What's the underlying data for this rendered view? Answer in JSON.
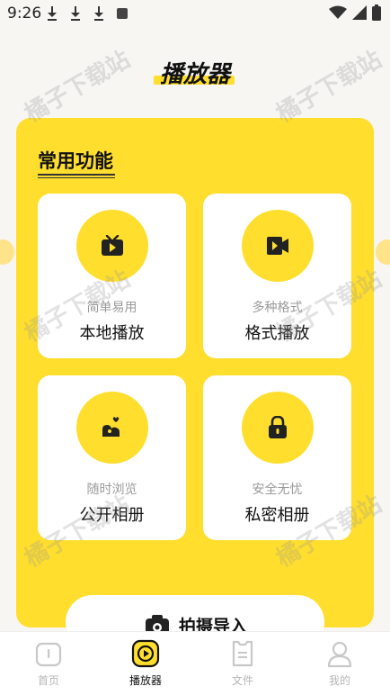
{
  "status": {
    "time": "9:26"
  },
  "header": {
    "title": "播放器"
  },
  "section": {
    "title": "常用功能"
  },
  "cards": [
    {
      "subtitle": "简单易用",
      "label": "本地播放",
      "icon": "tv-play-icon"
    },
    {
      "subtitle": "多种格式",
      "label": "格式播放",
      "icon": "video-file-icon"
    },
    {
      "subtitle": "随时浏览",
      "label": "公开相册",
      "icon": "photo-heart-icon"
    },
    {
      "subtitle": "安全无忧",
      "label": "私密相册",
      "icon": "lock-icon"
    }
  ],
  "capture": {
    "label": "拍摄导入",
    "icon": "camera-icon"
  },
  "tabs": [
    {
      "label": "首页",
      "icon": "home-icon"
    },
    {
      "label": "播放器",
      "icon": "player-icon"
    },
    {
      "label": "文件",
      "icon": "file-icon"
    },
    {
      "label": "我的",
      "icon": "user-icon"
    }
  ],
  "watermark": "橘子下载站",
  "colors": {
    "accent": "#ffde2e",
    "background": "#f7f6f3"
  }
}
